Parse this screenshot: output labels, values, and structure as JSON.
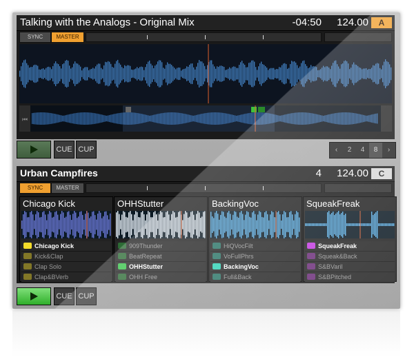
{
  "deck_a": {
    "title": "Talking with the Analogs - Original Mix",
    "time": "-04:50",
    "bpm": "124.00",
    "letter": "A",
    "sync": "SYNC",
    "master": "MASTER",
    "cue": "CUE",
    "cup": "CUP",
    "pager": [
      "2",
      "4",
      "8"
    ]
  },
  "deck_c": {
    "title": "Urban Campfires",
    "beats": "4",
    "bpm": "124.00",
    "letter": "C",
    "sync": "SYNC",
    "master": "MASTER",
    "cue": "CUE",
    "cup": "CUP",
    "slots": [
      {
        "name": "Chicago Kick",
        "color": "#f4dc2a",
        "cells": [
          "Chicago Kick",
          "Kick&Clap",
          "Clap Solo",
          "Clap&BVerb"
        ],
        "active": 0
      },
      {
        "name": "OHHStutter",
        "color": "#38c24a",
        "cells": [
          "909Thunder",
          "BeatRepeat",
          "OHHStutter",
          "OHH Free"
        ],
        "active": 2
      },
      {
        "name": "BackingVoc",
        "color": "#2ed0b4",
        "cells": [
          "HiQVocFilt",
          "VoFullPhrs",
          "BackingVoc",
          "Full&Back"
        ],
        "active": 2
      },
      {
        "name": "SqueakFreak",
        "color": "#c23ae0",
        "cells": [
          "SqueakFreak",
          "Squeak&Back",
          "S&BVaril",
          "S&BPitched"
        ],
        "active": 0
      }
    ]
  },
  "colors": {
    "orange": "#f0a030",
    "green_play": "#3fc23a",
    "wave_blue": "#4a8fd8"
  }
}
